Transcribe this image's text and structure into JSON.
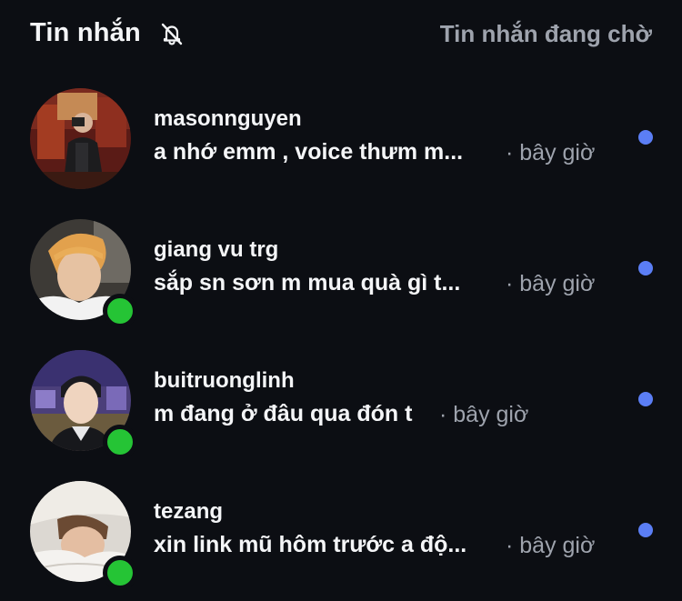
{
  "header": {
    "title": "Tin nhắn",
    "requests_label": "Tin nhắn đang chờ"
  },
  "threads": [
    {
      "name": "masonnguyen",
      "preview": "a nhớ emm , voice thưm m...",
      "time": "· bây giờ",
      "online": false,
      "unread": true
    },
    {
      "name": "giang vu trg",
      "preview": "sắp sn sơn m mua quà gì t...",
      "time": "· bây giờ",
      "online": true,
      "unread": true
    },
    {
      "name": "buitruonglinh",
      "preview": "m đang ở đâu qua đón t",
      "time": "· bây giờ",
      "online": true,
      "unread": true
    },
    {
      "name": "tezang",
      "preview": "xin link mũ hôm trước a độ...",
      "time": "· bây giờ",
      "online": true,
      "unread": true
    }
  ],
  "colors": {
    "background": "#0c0e13",
    "unread_dot": "#5b7ef5",
    "online_dot": "#25c435",
    "muted_text": "#9ea3ad"
  }
}
